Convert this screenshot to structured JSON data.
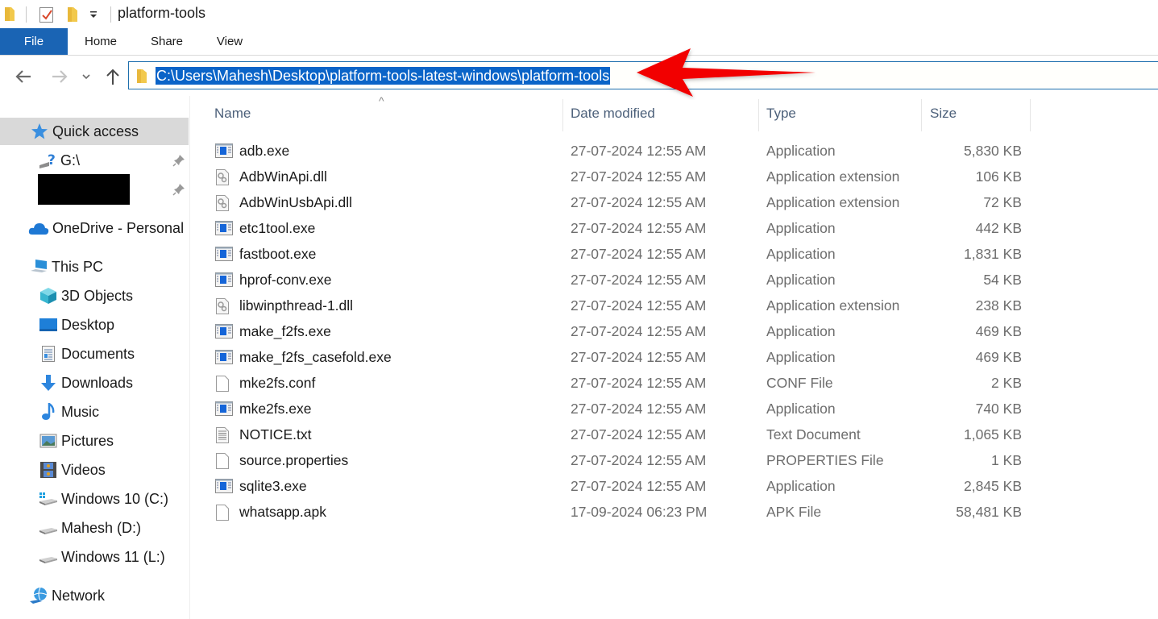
{
  "window": {
    "title": "platform-tools"
  },
  "ribbon": {
    "tabs": [
      {
        "label": "File",
        "active": true
      },
      {
        "label": "Home"
      },
      {
        "label": "Share"
      },
      {
        "label": "View"
      }
    ]
  },
  "navigation": {
    "back_icon": "arrow-left-icon",
    "forward_icon": "arrow-right-icon",
    "recent_icon": "chevron-down-icon",
    "up_icon": "arrow-up-icon",
    "address_path": "C:\\Users\\Mahesh\\Desktop\\platform-tools-latest-windows\\platform-tools",
    "address_selected": true
  },
  "annotation": {
    "type": "red-arrow",
    "color": "#f20000",
    "points_to": "address-bar"
  },
  "sidebar": {
    "items": [
      {
        "label": "Quick access",
        "icon": "star-icon",
        "selected": true
      },
      {
        "label": "G:\\",
        "icon": "unknown-drive-icon",
        "pinned": true
      },
      {
        "label": "",
        "icon": "redacted",
        "pinned": true,
        "redacted": true
      },
      {
        "label": "OneDrive - Personal",
        "icon": "cloud-icon"
      },
      {
        "label": "This PC",
        "icon": "computer-icon"
      },
      {
        "label": "3D Objects",
        "icon": "cube-icon"
      },
      {
        "label": "Desktop",
        "icon": "desktop-icon"
      },
      {
        "label": "Documents",
        "icon": "document-icon"
      },
      {
        "label": "Downloads",
        "icon": "download-icon"
      },
      {
        "label": "Music",
        "icon": "music-note-icon"
      },
      {
        "label": "Pictures",
        "icon": "picture-icon"
      },
      {
        "label": "Videos",
        "icon": "film-icon"
      },
      {
        "label": "Windows 10 (C:)",
        "icon": "windows-drive-icon"
      },
      {
        "label": "Mahesh (D:)",
        "icon": "drive-icon"
      },
      {
        "label": "Windows 11 (L:)",
        "icon": "drive-icon"
      },
      {
        "label": "Network",
        "icon": "network-icon"
      }
    ]
  },
  "filelist": {
    "columns": [
      {
        "label": "Name",
        "sorted": "ascending"
      },
      {
        "label": "Date modified"
      },
      {
        "label": "Type"
      },
      {
        "label": "Size"
      }
    ],
    "files": [
      {
        "name": "adb.exe",
        "date": "27-07-2024 12:55 AM",
        "type": "Application",
        "size": "5,830 KB",
        "icon": "exe"
      },
      {
        "name": "AdbWinApi.dll",
        "date": "27-07-2024 12:55 AM",
        "type": "Application extension",
        "size": "106 KB",
        "icon": "dll"
      },
      {
        "name": "AdbWinUsbApi.dll",
        "date": "27-07-2024 12:55 AM",
        "type": "Application extension",
        "size": "72 KB",
        "icon": "dll"
      },
      {
        "name": "etc1tool.exe",
        "date": "27-07-2024 12:55 AM",
        "type": "Application",
        "size": "442 KB",
        "icon": "exe"
      },
      {
        "name": "fastboot.exe",
        "date": "27-07-2024 12:55 AM",
        "type": "Application",
        "size": "1,831 KB",
        "icon": "exe"
      },
      {
        "name": "hprof-conv.exe",
        "date": "27-07-2024 12:55 AM",
        "type": "Application",
        "size": "54 KB",
        "icon": "exe"
      },
      {
        "name": "libwinpthread-1.dll",
        "date": "27-07-2024 12:55 AM",
        "type": "Application extension",
        "size": "238 KB",
        "icon": "dll"
      },
      {
        "name": "make_f2fs.exe",
        "date": "27-07-2024 12:55 AM",
        "type": "Application",
        "size": "469 KB",
        "icon": "exe"
      },
      {
        "name": "make_f2fs_casefold.exe",
        "date": "27-07-2024 12:55 AM",
        "type": "Application",
        "size": "469 KB",
        "icon": "exe"
      },
      {
        "name": "mke2fs.conf",
        "date": "27-07-2024 12:55 AM",
        "type": "CONF File",
        "size": "2 KB",
        "icon": "blank"
      },
      {
        "name": "mke2fs.exe",
        "date": "27-07-2024 12:55 AM",
        "type": "Application",
        "size": "740 KB",
        "icon": "exe"
      },
      {
        "name": "NOTICE.txt",
        "date": "27-07-2024 12:55 AM",
        "type": "Text Document",
        "size": "1,065 KB",
        "icon": "txt"
      },
      {
        "name": "source.properties",
        "date": "27-07-2024 12:55 AM",
        "type": "PROPERTIES File",
        "size": "1 KB",
        "icon": "blank"
      },
      {
        "name": "sqlite3.exe",
        "date": "27-07-2024 12:55 AM",
        "type": "Application",
        "size": "2,845 KB",
        "icon": "exe"
      },
      {
        "name": "whatsapp.apk",
        "date": "17-09-2024 06:23 PM",
        "type": "APK File",
        "size": "58,481 KB",
        "icon": "blank"
      }
    ]
  },
  "colors": {
    "file_tab_bg": "#1a64b4",
    "selection": "#0a64c8",
    "address_border": "#1e6fad",
    "sidebar_selected": "#d9d9d9",
    "header_text": "#4c607a",
    "secondary_text": "#6d6d6d"
  }
}
